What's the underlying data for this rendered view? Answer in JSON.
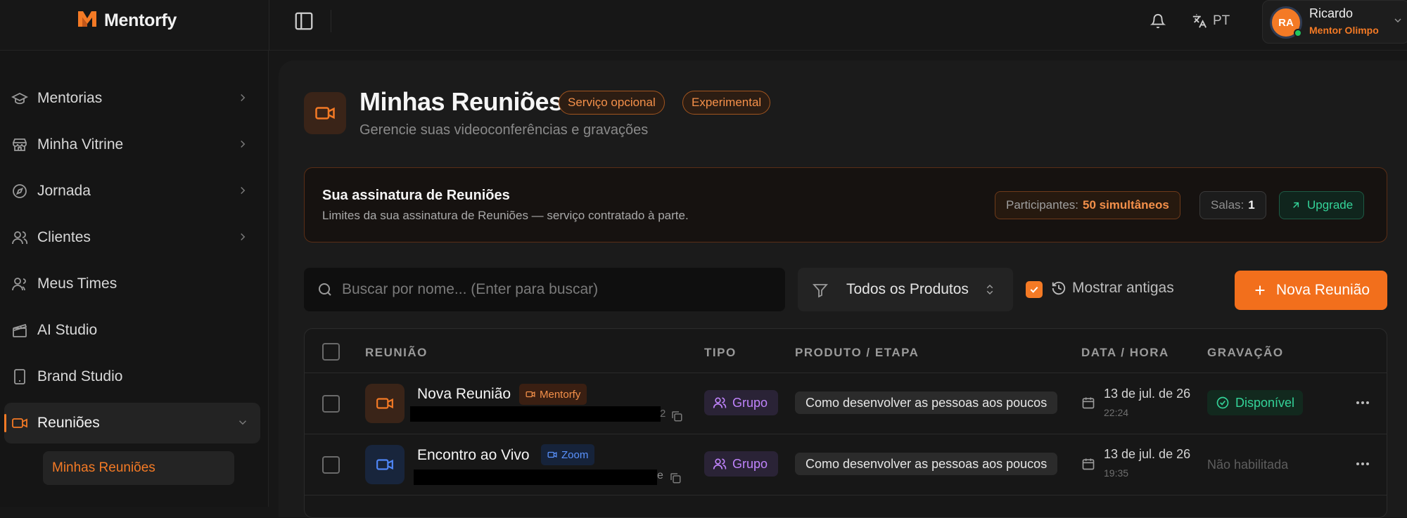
{
  "app": {
    "brand": "Mentorfy",
    "accent": "#f47a25"
  },
  "topbar": {
    "lang": "PT",
    "user": {
      "initials": "RA",
      "name": "Ricardo",
      "role": "Mentor Olimpo"
    }
  },
  "sidebar": {
    "items": [
      {
        "label": "Mentorias",
        "icon": "graduation-cap-icon",
        "chevron": true
      },
      {
        "label": "Minha Vitrine",
        "icon": "store-icon",
        "chevron": true
      },
      {
        "label": "Jornada",
        "icon": "compass-icon",
        "chevron": true
      },
      {
        "label": "Clientes",
        "icon": "users-icon",
        "chevron": true
      },
      {
        "label": "Meus Times",
        "icon": "team-icon",
        "chevron": false
      },
      {
        "label": "AI Studio",
        "icon": "clapperboard-icon",
        "chevron": false
      },
      {
        "label": "Brand Studio",
        "icon": "tablet-icon",
        "chevron": false
      },
      {
        "label": "Reuniões",
        "icon": "video-icon",
        "chevron": true,
        "active": true
      }
    ],
    "subitem": "Minhas Reuniões"
  },
  "page": {
    "title": "Minhas Reuniões",
    "badges": [
      "Serviço opcional",
      "Experimental"
    ],
    "subtitle": "Gerencie suas videoconferências e gravações"
  },
  "subscription": {
    "title": "Sua assinatura de Reuniões",
    "desc": "Limites da sua assinatura de Reuniões — serviço contratado à parte.",
    "participants_label": "Participantes:",
    "participants_value": "50 simultâneos",
    "rooms_label": "Salas:",
    "rooms_value": "1",
    "upgrade": "Upgrade"
  },
  "toolbar": {
    "search_placeholder": "Buscar por nome... (Enter para buscar)",
    "filter_value": "Todos os Produtos",
    "show_old_label": "Mostrar antigas",
    "show_old_checked": true,
    "new_button": "Nova Reunião"
  },
  "table": {
    "headers": [
      "REUNIÃO",
      "TIPO",
      "PRODUTO / ETAPA",
      "DATA / HORA",
      "GRAVAÇÃO"
    ],
    "rows": [
      {
        "name": "Nova Reunião",
        "platform": "Mentorfy",
        "link_tail": "2",
        "type": "Grupo",
        "product": "Como desenvolver as pessoas aos poucos",
        "date": "13 de jul. de 26",
        "time": "22:24",
        "recording": "Disponível"
      },
      {
        "name": "Encontro ao Vivo",
        "platform": "Zoom",
        "link_tail": "e",
        "type": "Grupo",
        "product": "Como desenvolver as pessoas aos poucos",
        "date": "13 de jul. de 26",
        "time": "19:35",
        "recording": "Não habilitada"
      }
    ]
  }
}
